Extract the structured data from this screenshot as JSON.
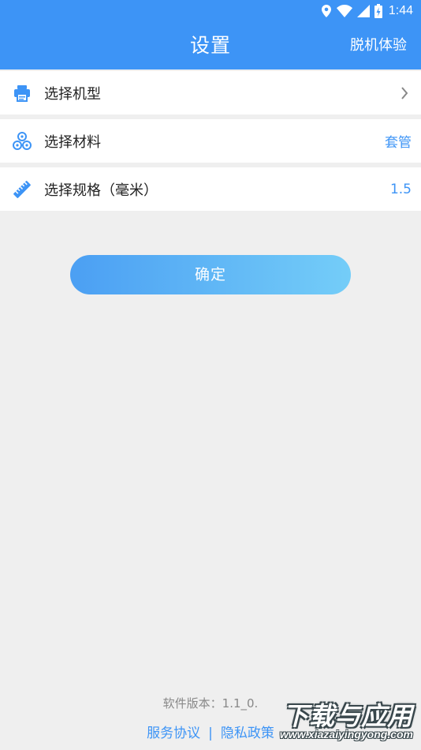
{
  "status_bar": {
    "time": "1:44"
  },
  "app_bar": {
    "title": "设置",
    "action_label": "脱机体验"
  },
  "settings": [
    {
      "label": "选择机型",
      "value": "",
      "icon": "printer-icon"
    },
    {
      "label": "选择材料",
      "value": "套管",
      "icon": "material-rolls-icon"
    },
    {
      "label": "选择规格（毫米）",
      "value": "1.5",
      "icon": "ruler-icon"
    }
  ],
  "confirm_label": "确定",
  "footer": {
    "version": "软件版本：1.1_0.",
    "service_agreement": "服务协议",
    "separator": "|",
    "privacy_policy": "隐私政策"
  },
  "watermark": {
    "main": "下载与应用",
    "sub": "www.xiazaiyingyong.com"
  },
  "colors": {
    "primary": "#3d94f6",
    "background": "#efefef",
    "button_start": "#4b9ff3",
    "button_end": "#74cdf8"
  }
}
